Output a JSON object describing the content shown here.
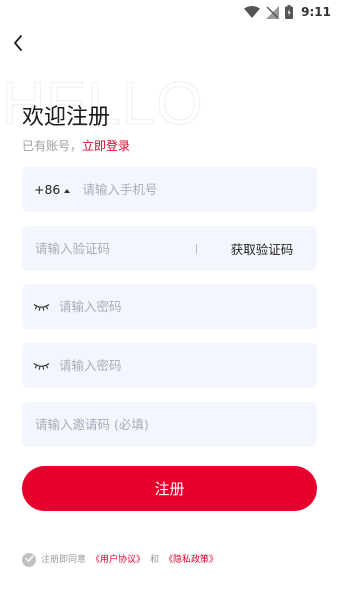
{
  "status_bar": {
    "time": "9:11",
    "icons": [
      "wifi-icon",
      "no-signal-icon",
      "battery-icon"
    ]
  },
  "header": {
    "back_icon": "back-arrow-icon",
    "watermark": "HELLO"
  },
  "title": "欢迎注册",
  "login_hint": {
    "prefix": "已有账号，",
    "link": "立即登录"
  },
  "form": {
    "country_code": "+86",
    "phone_placeholder": "请输入手机号",
    "code_placeholder": "请输入验证码",
    "get_code_label": "获取验证码",
    "password_placeholder": "请输入密码",
    "confirm_password_placeholder": "请输入密码",
    "invite_placeholder": "请输入邀请码 (必填)"
  },
  "submit_label": "注册",
  "agreement": {
    "prefix": "注册即同意",
    "user_agreement": "《用户协议》",
    "conjunction": "和",
    "privacy_policy": "《隐私政策》"
  },
  "colors": {
    "accent": "#e6002d",
    "field_bg": "#f4f6fd",
    "link": "#e3002c"
  }
}
